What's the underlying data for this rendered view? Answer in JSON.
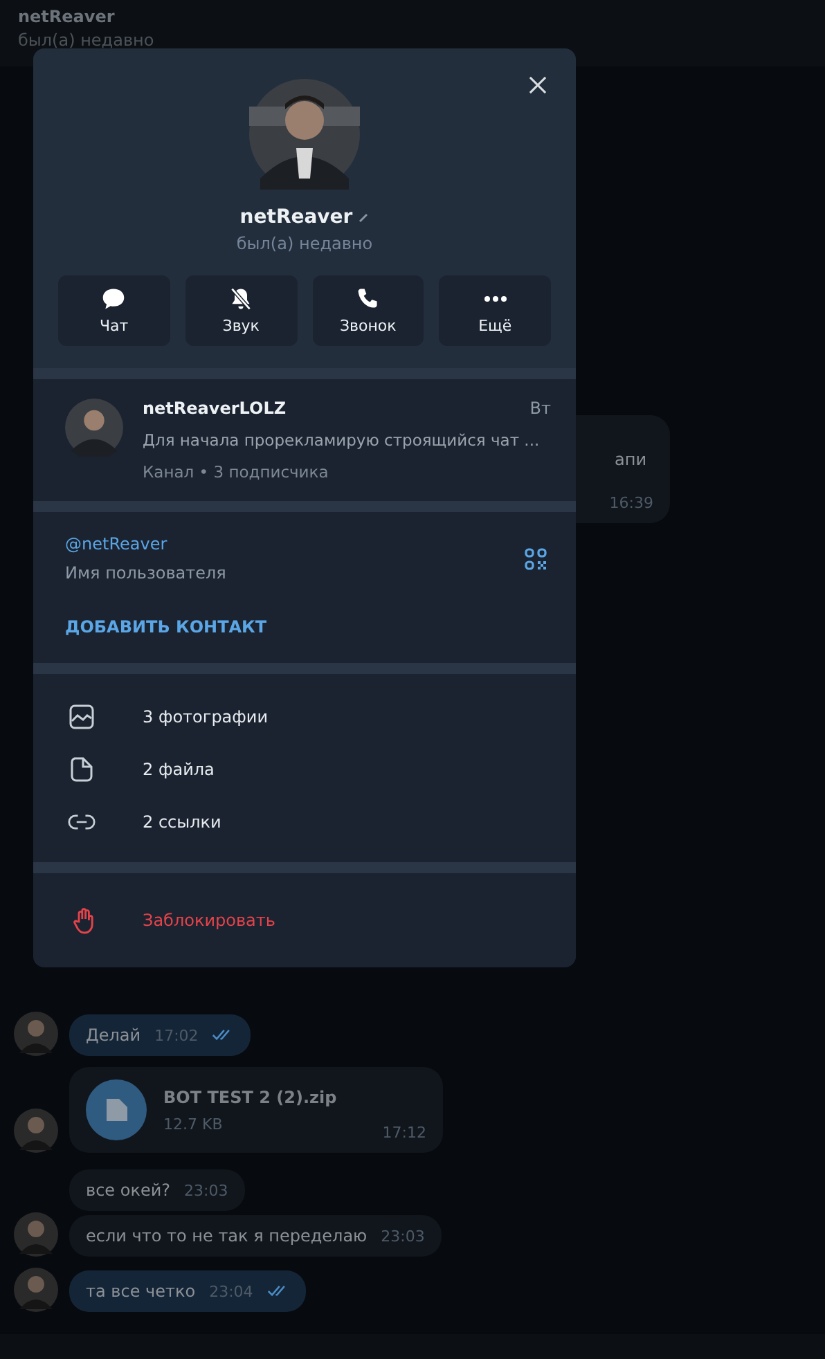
{
  "chat_header": {
    "name": "netReaver",
    "status": "был(а) недавно"
  },
  "messages": [
    {
      "kind": "text",
      "text": "апи",
      "time": "16:39",
      "outgoing": false,
      "read": false,
      "avatar": false
    },
    {
      "kind": "text",
      "text": "Делай",
      "time": "17:02",
      "outgoing": true,
      "read": true,
      "avatar": true
    },
    {
      "kind": "file",
      "text": "BOT TEST 2 (2).zip",
      "size": "12.7 KB",
      "time": "17:12",
      "outgoing": false,
      "read": false,
      "avatar": true
    },
    {
      "kind": "text",
      "text": "все окей?",
      "time": "23:03",
      "outgoing": false,
      "read": false,
      "avatar": false
    },
    {
      "kind": "text",
      "text": "если что то не так я переделаю",
      "time": "23:03",
      "outgoing": false,
      "read": false,
      "avatar": true
    },
    {
      "kind": "text",
      "text": "та все четко",
      "time": "23:04",
      "outgoing": true,
      "read": true,
      "avatar": true
    }
  ],
  "profile": {
    "name": "netReaver",
    "status": "был(а) недавно",
    "actions": [
      {
        "kind": "chat",
        "label": "Чат"
      },
      {
        "kind": "mute",
        "label": "Звук"
      },
      {
        "kind": "call",
        "label": "Звонок"
      },
      {
        "kind": "more",
        "label": "Ещё"
      }
    ],
    "channel": {
      "name": "netReaverLOLZ",
      "day": "Вт",
      "preview": "Для начала прорекламирую строящийся чат ...",
      "meta": "Канал • 3 подписчика"
    },
    "username": "@netReaver",
    "username_label": "Имя пользователя",
    "add_contact": "ДОБАВИТЬ КОНТАКТ",
    "media": [
      {
        "kind": "photos",
        "label": "3 фотографии"
      },
      {
        "kind": "files",
        "label": "2 файла"
      },
      {
        "kind": "links",
        "label": "2 ссылки"
      }
    ],
    "block": "Заблокировать"
  }
}
